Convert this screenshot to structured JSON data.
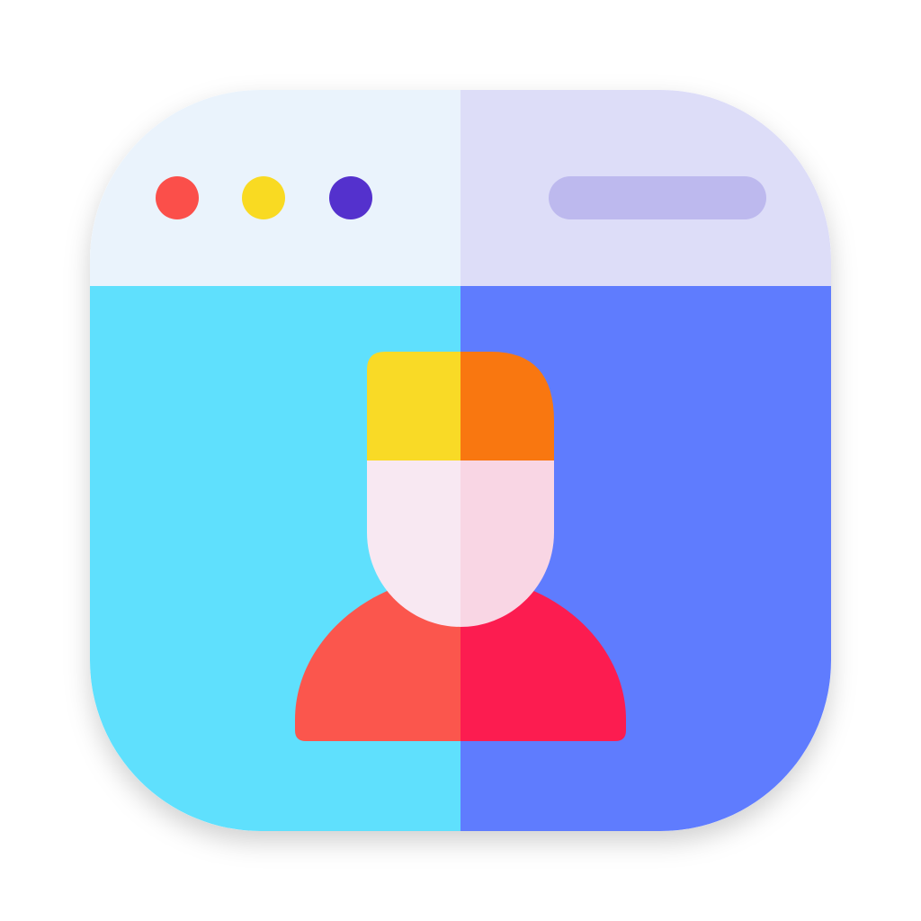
{
  "icon": {
    "name": "profile-browser-app-icon",
    "colors": {
      "titlebar_left": "#EAF3FC",
      "titlebar_right": "#DDDDF8",
      "address_bar": "#BDB9EE",
      "body_left": "#5FE0FD",
      "body_right": "#5F7CFE",
      "window_dot_red": "#FB4F4A",
      "window_dot_yellow": "#F9DA22",
      "window_dot_purple": "#5431CD",
      "hair_left": "#F9DA26",
      "hair_right": "#F97710",
      "face_left": "#F8E8F2",
      "face_right": "#F9D6E4",
      "shoulders_left": "#FB564D",
      "shoulders_right": "#FC1C50"
    }
  }
}
